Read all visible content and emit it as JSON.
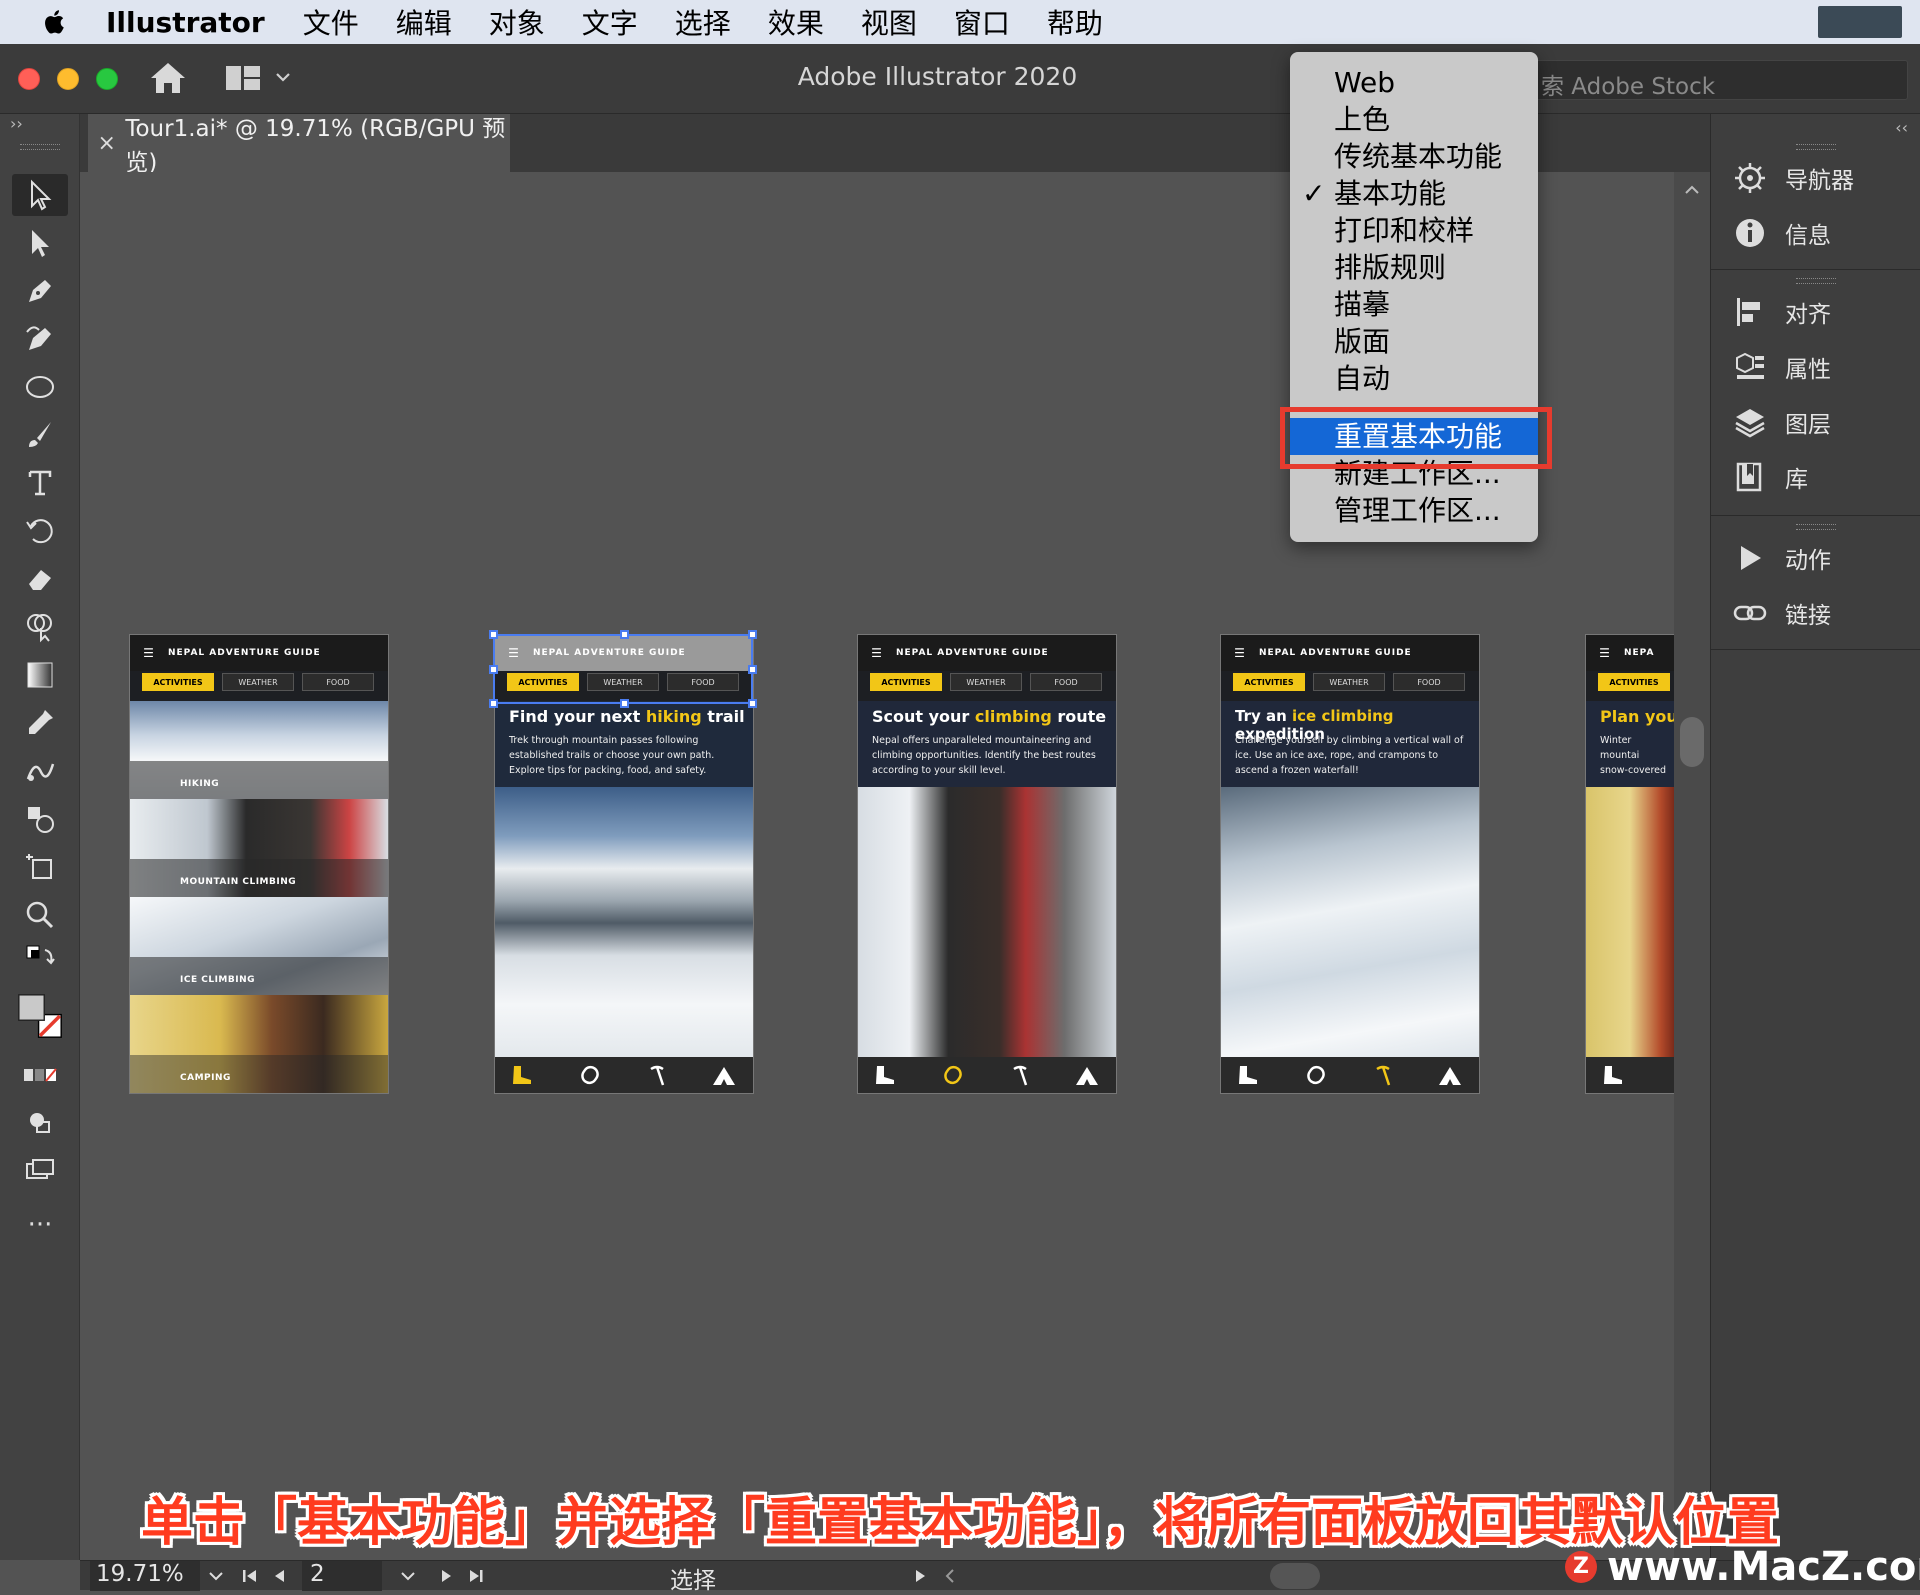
{
  "menubar": {
    "app": "Illustrator",
    "items": [
      "文件",
      "编辑",
      "对象",
      "文字",
      "选择",
      "效果",
      "视图",
      "窗口",
      "帮助"
    ]
  },
  "appbar": {
    "title": "Adobe Illustrator 2020",
    "stock_placeholder": "索 Adobe Stock"
  },
  "toolbar": {
    "collapse": "››",
    "more": "···"
  },
  "document_tab": {
    "close": "×",
    "title": "Tour1.ai* @ 19.71% (RGB/GPU 预览)"
  },
  "right_panel": {
    "collapse": "‹‹",
    "groups": [
      [
        {
          "label": "导航器",
          "icon": "navigator-icon"
        },
        {
          "label": "信息",
          "icon": "info-icon"
        }
      ],
      [
        {
          "label": "对齐",
          "icon": "align-icon"
        },
        {
          "label": "属性",
          "icon": "properties-icon"
        },
        {
          "label": "图层",
          "icon": "layers-icon"
        },
        {
          "label": "库",
          "icon": "libraries-icon"
        }
      ],
      [
        {
          "label": "动作",
          "icon": "actions-icon"
        },
        {
          "label": "链接",
          "icon": "links-icon"
        }
      ]
    ]
  },
  "workspace_menu": {
    "items": [
      "Web",
      "上色",
      "传统基本功能",
      "基本功能",
      "打印和校样",
      "排版规则",
      "描摹",
      "版面",
      "自动"
    ],
    "checked": "基本功能",
    "check_mark": "✓",
    "actions": [
      "重置基本功能",
      "新建工作区...",
      "管理工作区..."
    ],
    "highlighted": "重置基本功能",
    "highlight_color": "#1467d6"
  },
  "artboards": {
    "header": "NEPAL ADVENTURE GUIDE",
    "tabs": [
      "ACTIVITIES",
      "WEATHER",
      "FOOD"
    ],
    "list_labels": [
      "HIKING",
      "MOUNTAIN CLIMBING",
      "ICE CLIMBING",
      "CAMPING"
    ],
    "hiking": {
      "headline_a": "Find your next ",
      "headline_b": "hiking",
      "headline_c": " trail",
      "desc": "Trek through mountain passes following established trails or choose your own path. Explore tips for packing, food, and safety."
    },
    "climbing": {
      "headline_a": "Scout your ",
      "headline_b": "climbing",
      "headline_c": " route",
      "desc": "Nepal offers unparalleled mountaineering and climbing opportunities. Identify the best routes according to your skill level."
    },
    "ice": {
      "headline_a": "Try an ",
      "headline_b": "ice climbing",
      "headline_c": " expedition",
      "desc": "Challenge yourself by climbing a vertical wall of ice. Use an ice axe, rope, and crampons to ascend a frozen waterfall!"
    },
    "camping": {
      "headline": "Plan your",
      "desc": "Winter mountai snow-covered s considering win"
    },
    "partial_header": "NEPA",
    "partial_tab": "ACTIVITIES",
    "accent_color": "#f2c617"
  },
  "caption": "单击「基本功能」并选择「重置基本功能」，将所有面板放回其默认位置",
  "statusbar": {
    "zoom": "19.71%",
    "page": "2",
    "mode": "选择"
  },
  "watermark": {
    "logo": "Z",
    "text": "www.MacZ.com"
  }
}
